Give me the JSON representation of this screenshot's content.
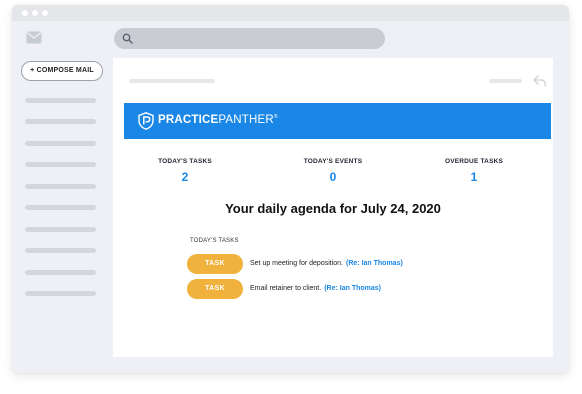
{
  "sidebar": {
    "compose_label": "+ COMPOSE MAIL"
  },
  "search": {
    "placeholder": ""
  },
  "brand": {
    "name_bold": "PRACTICE",
    "name_light": "PANTHER",
    "trademark": "®",
    "color": "#1a86e5"
  },
  "stats": [
    {
      "label": "TODAY'S TASKS",
      "value": "2"
    },
    {
      "label": "TODAY'S EVENTS",
      "value": "0"
    },
    {
      "label": "OVERDUE TASKS",
      "value": "1"
    }
  ],
  "agenda": {
    "title": "Your daily agenda for July 24, 2020",
    "section_label": "TODAY'S TASKS",
    "tasks": [
      {
        "pill": "TASK",
        "text": "Set up meeting for deposition.",
        "ref": "(Re: Ian Thomas)"
      },
      {
        "pill": "TASK",
        "text": "Email retainer to client.",
        "ref": "(Re: Ian Thomas)"
      }
    ]
  },
  "colors": {
    "accent": "#1a86e5",
    "task_pill": "#f0b23c"
  },
  "icons": [
    "mail-icon",
    "search-icon",
    "reply-icon",
    "practicepanther-logo-icon"
  ]
}
